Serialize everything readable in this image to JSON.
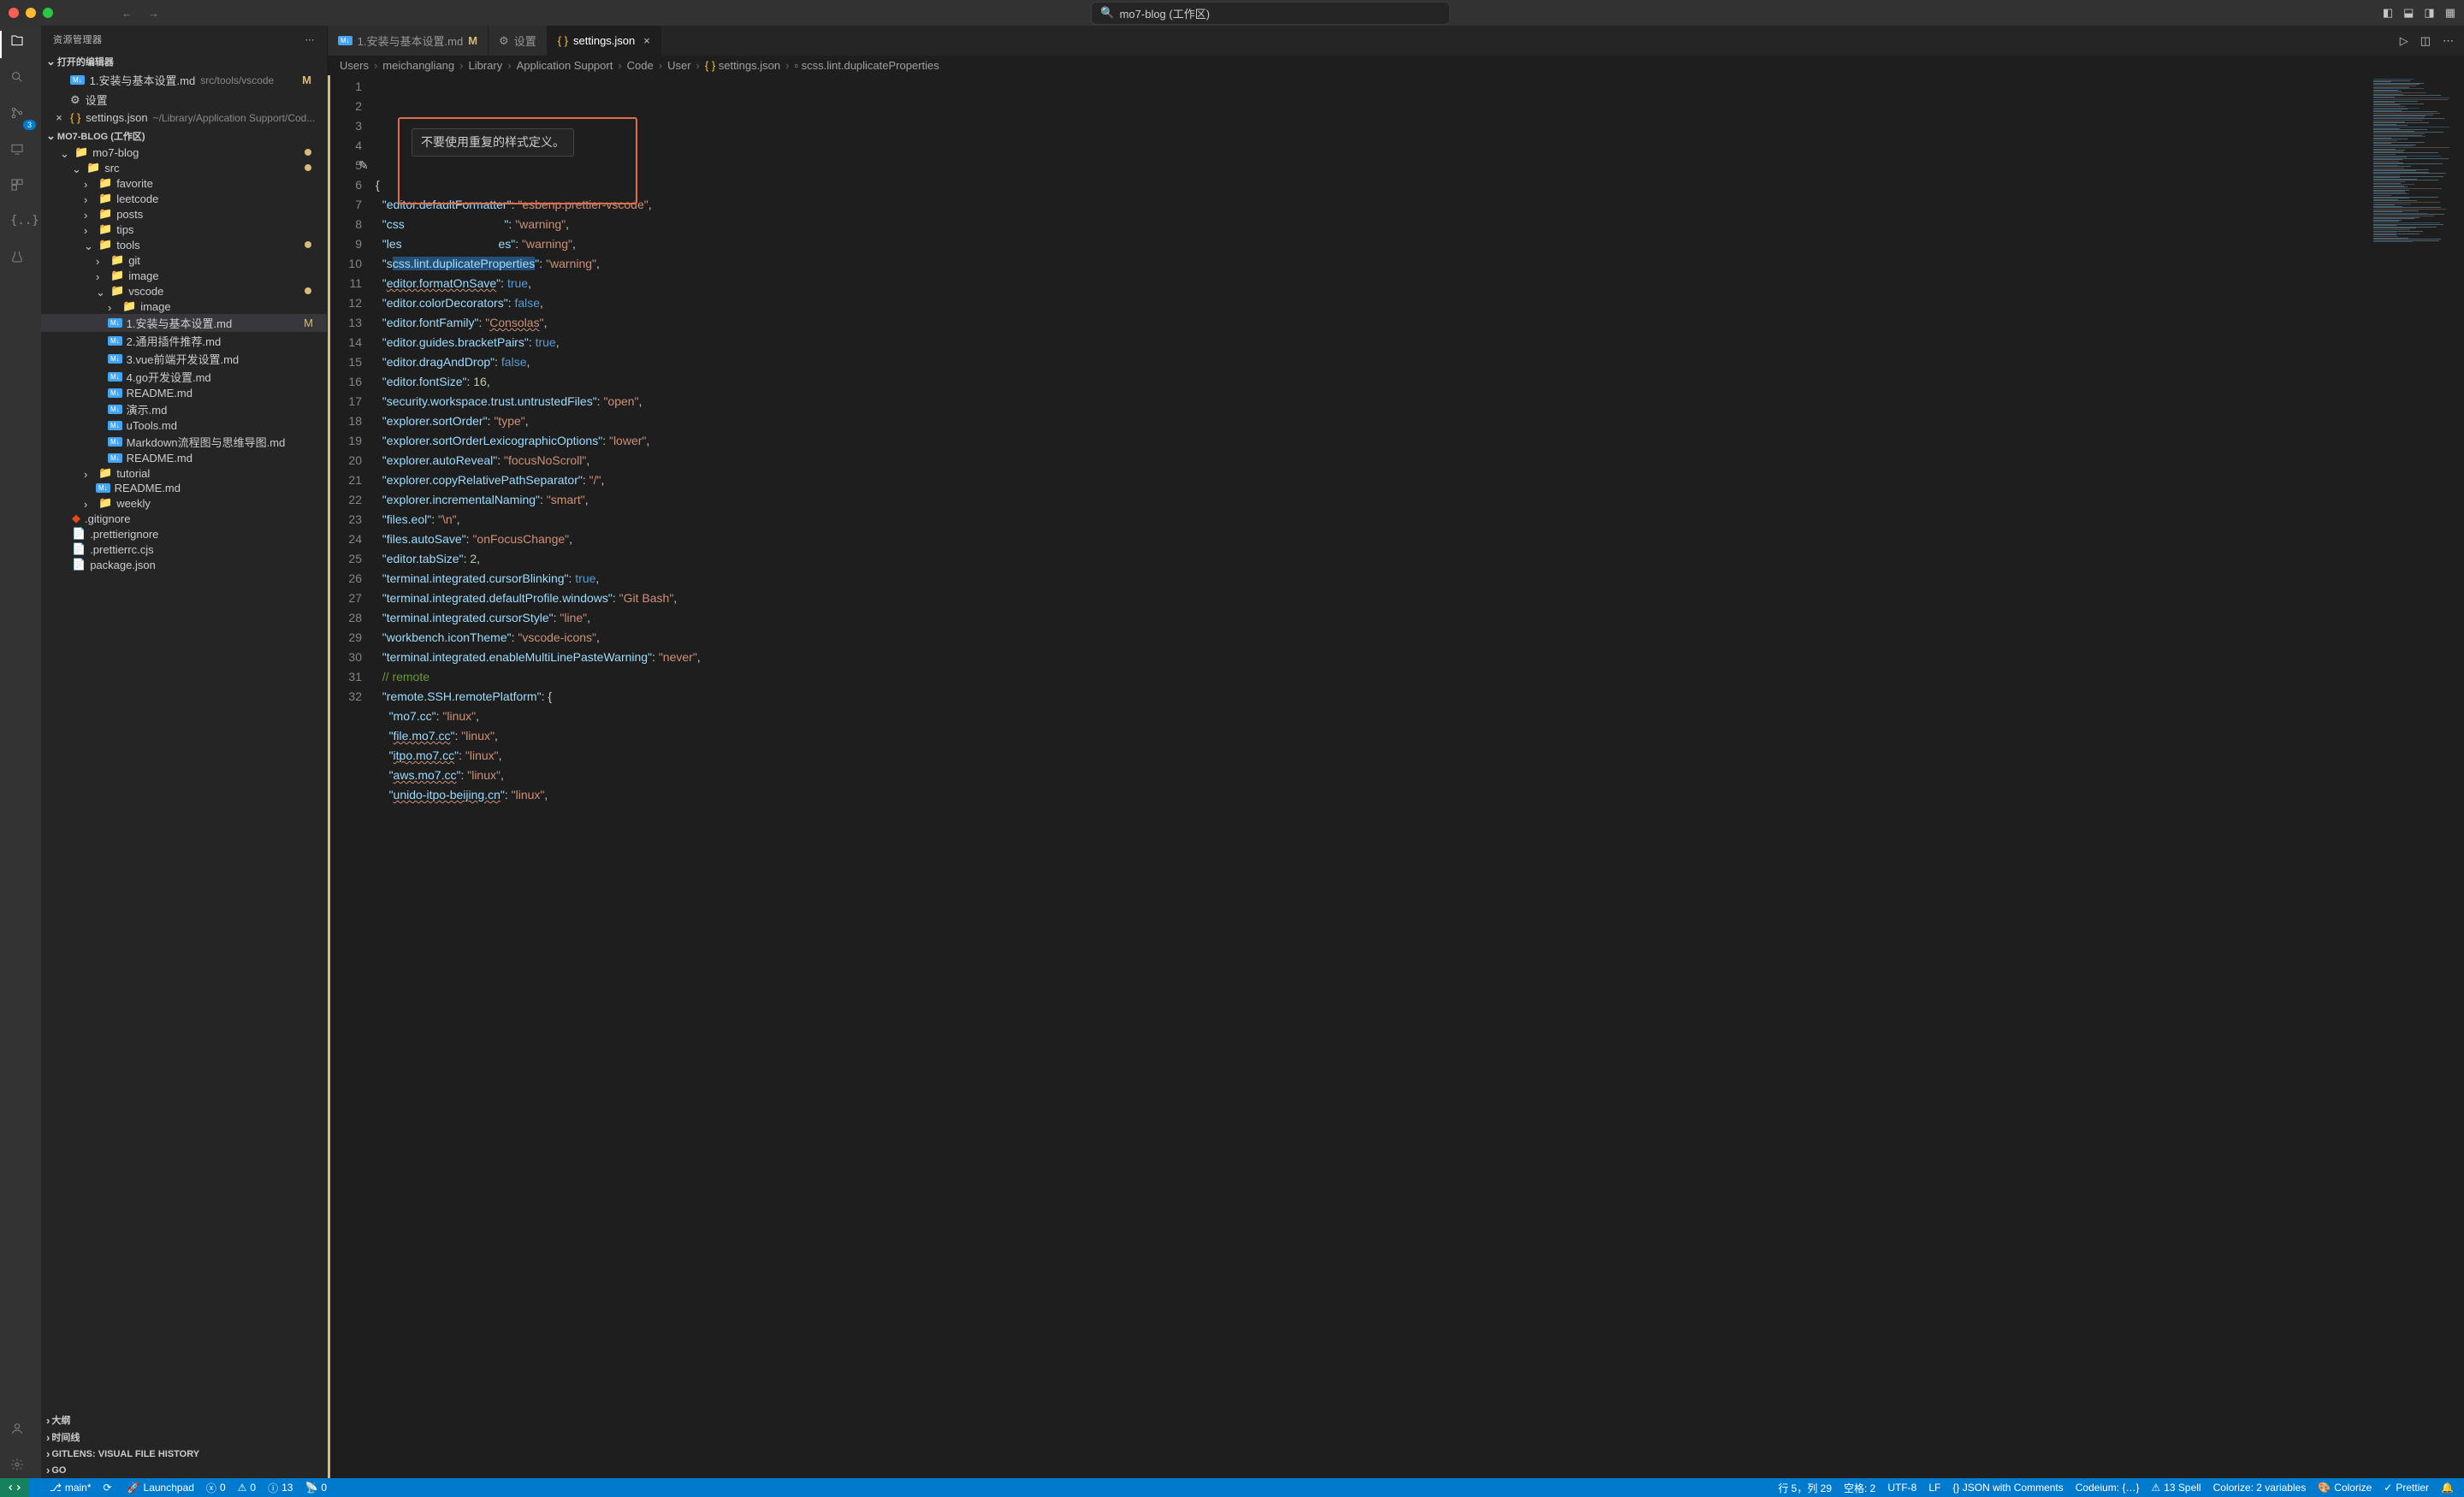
{
  "titlebar": {
    "search_prefix": "",
    "search_text": "mo7-blog (工作区)"
  },
  "layout_icons": [
    "panel-left",
    "panel-bottom",
    "panel-right",
    "layout"
  ],
  "activitybar": {
    "items": [
      "explorer",
      "search",
      "scm",
      "remote",
      "extensions",
      "json"
    ],
    "scm_badge": "3"
  },
  "sidebar": {
    "title": "资源管理器",
    "open_editors_label": "打开的编辑器",
    "open_editors": [
      {
        "icon": "md",
        "name": "1.安装与基本设置.md",
        "hint": "src/tools/vscode",
        "mod": "M"
      },
      {
        "icon": "gear",
        "name": "设置",
        "hint": "",
        "mod": ""
      },
      {
        "icon": "json",
        "name": "settings.json",
        "hint": "~/Library/Application Support/Cod...",
        "mod": "",
        "close": true
      }
    ],
    "workspace_label": "MO7-BLOG (工作区)",
    "tree": [
      {
        "d": 1,
        "type": "folder-open",
        "name": "mo7-blog",
        "mod": "dot"
      },
      {
        "d": 2,
        "type": "folder-open-src",
        "name": "src",
        "mod": "dot"
      },
      {
        "d": 3,
        "type": "folder",
        "name": "favorite"
      },
      {
        "d": 3,
        "type": "folder",
        "name": "leetcode"
      },
      {
        "d": 3,
        "type": "folder",
        "name": "posts"
      },
      {
        "d": 3,
        "type": "folder",
        "name": "tips"
      },
      {
        "d": 3,
        "type": "folder-open",
        "name": "tools",
        "mod": "dot"
      },
      {
        "d": 4,
        "type": "folder",
        "name": "git"
      },
      {
        "d": 4,
        "type": "folder-img",
        "name": "image"
      },
      {
        "d": 4,
        "type": "folder-open-vs",
        "name": "vscode",
        "mod": "dot"
      },
      {
        "d": 5,
        "type": "folder-img",
        "name": "image"
      },
      {
        "d": 5,
        "type": "md",
        "name": "1.安装与基本设置.md",
        "mod": "M",
        "selected": true
      },
      {
        "d": 5,
        "type": "md",
        "name": "2.通用插件推荐.md"
      },
      {
        "d": 5,
        "type": "md",
        "name": "3.vue前端开发设置.md"
      },
      {
        "d": 5,
        "type": "md",
        "name": "4.go开发设置.md"
      },
      {
        "d": 5,
        "type": "md",
        "name": "README.md"
      },
      {
        "d": 5,
        "type": "md",
        "name": "演示.md"
      },
      {
        "d": 5,
        "type": "md",
        "name": "uTools.md"
      },
      {
        "d": 5,
        "type": "md",
        "name": "Markdown流程图与思维导图.md"
      },
      {
        "d": 5,
        "type": "md",
        "name": "README.md"
      },
      {
        "d": 3,
        "type": "folder",
        "name": "tutorial"
      },
      {
        "d": 4,
        "type": "md",
        "name": "README.md"
      },
      {
        "d": 3,
        "type": "folder",
        "name": "weekly"
      },
      {
        "d": 2,
        "type": "gitignore",
        "name": ".gitignore"
      },
      {
        "d": 2,
        "type": "file",
        "name": ".prettierignore"
      },
      {
        "d": 2,
        "type": "file",
        "name": ".prettierrc.cjs"
      },
      {
        "d": 2,
        "type": "file",
        "name": "package.json"
      }
    ],
    "panels": [
      "大纲",
      "时间线",
      "GITLENS: VISUAL FILE HISTORY",
      "GO"
    ]
  },
  "tabs": [
    {
      "icon": "md",
      "label": "1.安装与基本设置.md",
      "mod": "M",
      "active": false
    },
    {
      "icon": "gear",
      "label": "设置",
      "active": false
    },
    {
      "icon": "json",
      "label": "settings.json",
      "active": true,
      "close": true
    }
  ],
  "breadcrumbs": [
    "Users",
    "meichangliang",
    "Library",
    "Application Support",
    "Code",
    "User",
    "{} settings.json",
    "scss.lint.duplicateProperties"
  ],
  "hover_tooltip": "不要使用重复的样式定义。",
  "code": [
    {
      "n": 1,
      "html": "<span class='tok-punct'>{</span>"
    },
    {
      "n": 2,
      "html": "  <span class='tok-key'>\"editor.defaultFormatter\"</span><span class='tok-punct'>: </span><span class='tok-str'>\"esbenp.prettier-vscode\"</span><span class='tok-punct'>,</span>"
    },
    {
      "n": 3,
      "html": "  <span class='tok-key'>\"css                              \"</span><span class='tok-punct'>: </span><span class='tok-str'>\"warning\"</span><span class='tok-punct'>,</span>"
    },
    {
      "n": 4,
      "html": "  <span class='tok-key'>\"les                             es\"</span><span class='tok-punct'>: </span><span class='tok-str'>\"warning\"</span><span class='tok-punct'>,</span>"
    },
    {
      "n": 5,
      "html": "  <span class='tok-key'>\"s<span class='sel-bg'>css.lint.duplicateProperties</span>\"</span><span class='tok-punct'>: </span><span class='tok-str'>\"warning\"</span><span class='tok-punct'>,</span>"
    },
    {
      "n": 6,
      "html": "  <span class='tok-key'>\"<span class='underline'>editor.formatOnSave</span>\"</span><span class='tok-punct'>: </span><span class='tok-bool'>true</span><span class='tok-punct'>,</span>"
    },
    {
      "n": 7,
      "html": "  <span class='tok-key'>\"editor.colorDecorators\"</span><span class='tok-punct'>: </span><span class='tok-bool'>false</span><span class='tok-punct'>,</span>"
    },
    {
      "n": 8,
      "html": "  <span class='tok-key'>\"editor.fontFamily\"</span><span class='tok-punct'>: </span><span class='tok-str'>\"<span class='underline'>Consolas</span>\"</span><span class='tok-punct'>,</span>"
    },
    {
      "n": 9,
      "html": "  <span class='tok-key'>\"editor.guides.bracketPairs\"</span><span class='tok-punct'>: </span><span class='tok-bool'>true</span><span class='tok-punct'>,</span>"
    },
    {
      "n": 10,
      "html": "  <span class='tok-key'>\"editor.dragAndDrop\"</span><span class='tok-punct'>: </span><span class='tok-bool'>false</span><span class='tok-punct'>,</span>"
    },
    {
      "n": 11,
      "html": "  <span class='tok-key'>\"editor.fontSize\"</span><span class='tok-punct'>: </span><span class='tok-num'>16</span><span class='tok-punct'>,</span>"
    },
    {
      "n": 12,
      "html": "  <span class='tok-key'>\"security.workspace.trust.untrustedFiles\"</span><span class='tok-punct'>: </span><span class='tok-str'>\"open\"</span><span class='tok-punct'>,</span>"
    },
    {
      "n": 13,
      "html": "  <span class='tok-key'>\"explorer.sortOrder\"</span><span class='tok-punct'>: </span><span class='tok-str'>\"type\"</span><span class='tok-punct'>,</span>"
    },
    {
      "n": 14,
      "html": "  <span class='tok-key'>\"explorer.sortOrderLexicographicOptions\"</span><span class='tok-punct'>: </span><span class='tok-str'>\"lower\"</span><span class='tok-punct'>,</span>"
    },
    {
      "n": 15,
      "html": "  <span class='tok-key'>\"explorer.autoReveal\"</span><span class='tok-punct'>: </span><span class='tok-str'>\"focusNoScroll\"</span><span class='tok-punct'>,</span>"
    },
    {
      "n": 16,
      "html": "  <span class='tok-key'>\"explorer.copyRelativePathSeparator\"</span><span class='tok-punct'>: </span><span class='tok-str'>\"/\"</span><span class='tok-punct'>,</span>"
    },
    {
      "n": 17,
      "html": "  <span class='tok-key'>\"explorer.incrementalNaming\"</span><span class='tok-punct'>: </span><span class='tok-str'>\"smart\"</span><span class='tok-punct'>,</span>"
    },
    {
      "n": 18,
      "html": "  <span class='tok-key'>\"files.eol\"</span><span class='tok-punct'>: </span><span class='tok-str'>\"\\n\"</span><span class='tok-punct'>,</span>"
    },
    {
      "n": 19,
      "html": "  <span class='tok-key'>\"files.autoSave\"</span><span class='tok-punct'>: </span><span class='tok-str'>\"onFocusChange\"</span><span class='tok-punct'>,</span>"
    },
    {
      "n": 20,
      "html": "  <span class='tok-key'>\"editor.tabSize\"</span><span class='tok-punct'>: </span><span class='tok-num'>2</span><span class='tok-punct'>,</span>"
    },
    {
      "n": 21,
      "html": "  <span class='tok-key'>\"terminal.integrated.cursorBlinking\"</span><span class='tok-punct'>: </span><span class='tok-bool'>true</span><span class='tok-punct'>,</span>"
    },
    {
      "n": 22,
      "html": "  <span class='tok-key'>\"terminal.integrated.defaultProfile.windows\"</span><span class='tok-punct'>: </span><span class='tok-str'>\"Git Bash\"</span><span class='tok-punct'>,</span>"
    },
    {
      "n": 23,
      "html": "  <span class='tok-key'>\"terminal.integrated.cursorStyle\"</span><span class='tok-punct'>: </span><span class='tok-str'>\"line\"</span><span class='tok-punct'>,</span>"
    },
    {
      "n": 24,
      "html": "  <span class='tok-key'>\"workbench.iconTheme\"</span><span class='tok-punct'>: </span><span class='tok-str'>\"vscode-icons\"</span><span class='tok-punct'>,</span>"
    },
    {
      "n": 25,
      "html": "  <span class='tok-key'>\"terminal.integrated.enableMultiLinePasteWarning\"</span><span class='tok-punct'>: </span><span class='tok-str'>\"never\"</span><span class='tok-punct'>,</span>"
    },
    {
      "n": 26,
      "html": "  <span class='tok-comment'>// remote</span>"
    },
    {
      "n": 27,
      "html": "  <span class='tok-key'>\"remote.SSH.remotePlatform\"</span><span class='tok-punct'>: {</span>"
    },
    {
      "n": 28,
      "html": "    <span class='tok-key'>\"mo7.cc\"</span><span class='tok-punct'>: </span><span class='tok-str'>\"linux\"</span><span class='tok-punct'>,</span>"
    },
    {
      "n": 29,
      "html": "    <span class='tok-key'>\"<span class='underline'>file.mo7.cc</span>\"</span><span class='tok-punct'>: </span><span class='tok-str'>\"linux\"</span><span class='tok-punct'>,</span>"
    },
    {
      "n": 30,
      "html": "    <span class='tok-key'>\"<span class='underline'>itpo.mo7.cc</span>\"</span><span class='tok-punct'>: </span><span class='tok-str'>\"linux\"</span><span class='tok-punct'>,</span>"
    },
    {
      "n": 31,
      "html": "    <span class='tok-key'>\"<span class='underline'>aws.mo7.cc</span>\"</span><span class='tok-punct'>: </span><span class='tok-str'>\"linux\"</span><span class='tok-punct'>,</span>"
    },
    {
      "n": 32,
      "html": "    <span class='tok-key'>\"<span class='underline'>unido-itpo-beijing.cn</span>\"</span><span class='tok-punct'>: </span><span class='tok-str'>\"linux\"</span><span class='tok-punct'>,</span>"
    }
  ],
  "statusbar": {
    "left": [
      {
        "icon": "remote",
        "text": ""
      },
      {
        "icon": "branch",
        "text": "main*"
      },
      {
        "icon": "sync",
        "text": ""
      },
      {
        "icon": "rocket",
        "text": "Launchpad"
      },
      {
        "icon": "err",
        "text": "0"
      },
      {
        "icon": "warn",
        "text": "0"
      },
      {
        "icon": "info",
        "text": "13"
      },
      {
        "icon": "ports",
        "text": "0"
      }
    ],
    "right": [
      {
        "text": "行 5，列 29"
      },
      {
        "text": "空格: 2"
      },
      {
        "text": "UTF-8"
      },
      {
        "text": "LF"
      },
      {
        "text": "{} JSON with Comments"
      },
      {
        "text": "Codeium: {…}"
      },
      {
        "icon": "warn",
        "text": "13 Spell"
      },
      {
        "text": "Colorize: 2 variables"
      },
      {
        "icon": "paint",
        "text": "Colorize"
      },
      {
        "icon": "check",
        "text": "Prettier"
      },
      {
        "icon": "bell",
        "text": ""
      }
    ]
  }
}
